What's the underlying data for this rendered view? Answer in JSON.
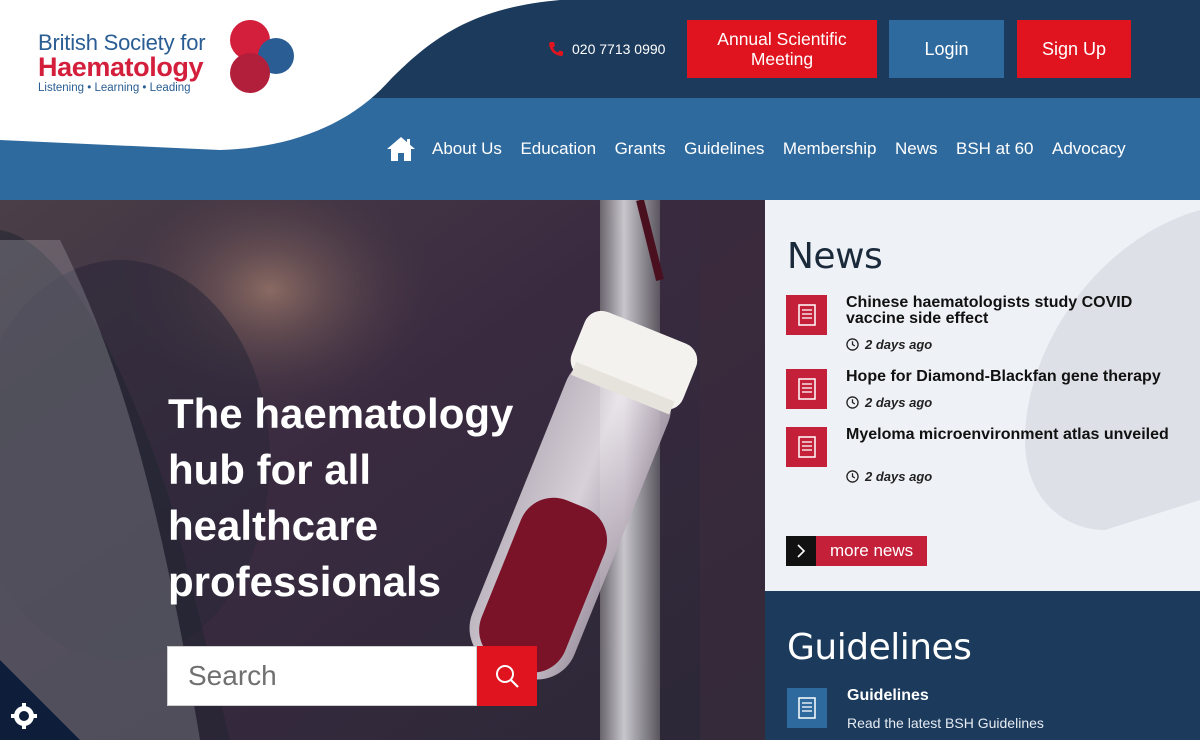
{
  "logo": {
    "line1": "British Society for",
    "line2": "Haematology",
    "tagline": "Listening • Learning • Leading"
  },
  "header": {
    "phone": "020 7713 0990",
    "buttons": {
      "annual_meeting": "Annual Scientific Meeting",
      "login": "Login",
      "signup": "Sign Up"
    }
  },
  "nav": {
    "items": [
      "About Us",
      "Education",
      "Grants",
      "Guidelines",
      "Membership",
      "News",
      "BSH at 60",
      "Advocacy"
    ]
  },
  "hero": {
    "title": "The haematology hub for all healthcare professionals",
    "search_placeholder": "Search"
  },
  "news": {
    "heading": "News",
    "items": [
      {
        "title": "Chinese haematologists study COVID vaccine side effect",
        "date": "2 days ago"
      },
      {
        "title": "Hope for Diamond-Blackfan gene therapy",
        "date": "2 days ago"
      },
      {
        "title": "Myeloma microenvironment atlas unveiled",
        "date": "2 days ago"
      }
    ],
    "more_label": "more news"
  },
  "guidelines": {
    "heading": "Guidelines",
    "item_title": "Guidelines",
    "item_desc": "Read the latest BSH Guidelines"
  },
  "colors": {
    "brand_red": "#e0141e",
    "news_red": "#c5203a",
    "navy": "#1b3a5c",
    "blue": "#2f6a9e"
  },
  "icons": [
    "phone-icon",
    "home-icon",
    "search-icon",
    "document-icon",
    "clock-icon",
    "chevron-right-icon",
    "cookie-settings-icon"
  ]
}
